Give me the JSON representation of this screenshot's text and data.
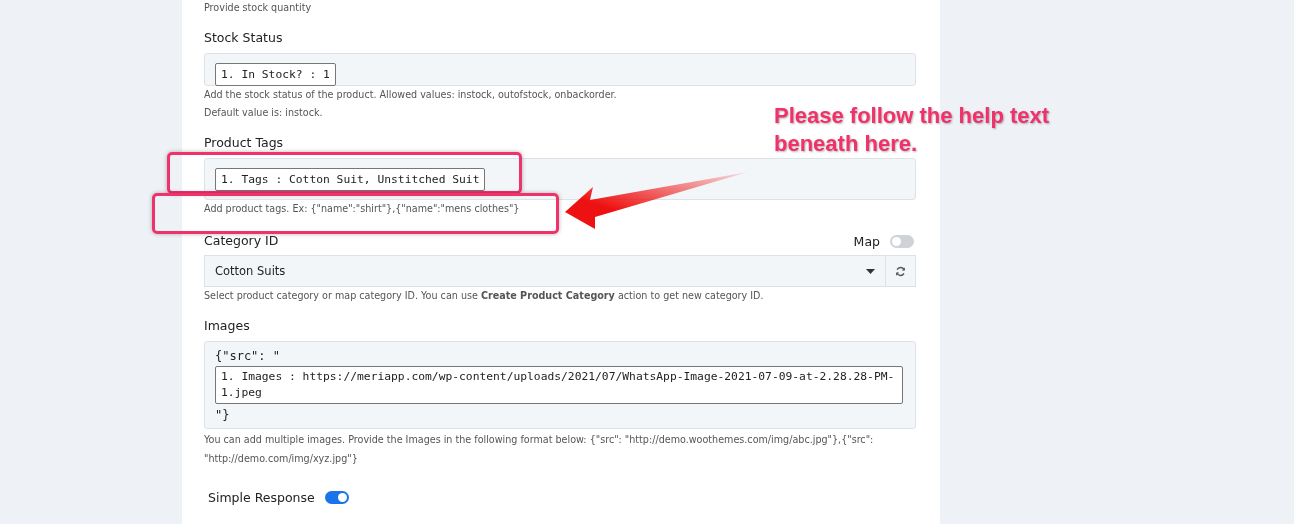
{
  "top_help": "Provide stock quantity",
  "stock_status": {
    "label": "Stock Status",
    "chip": "1. In Stock? : 1",
    "help": [
      "Add the stock status of the product. Allowed values: instock, outofstock, onbackorder.",
      "Default value is: instock."
    ]
  },
  "product_tags": {
    "label": "Product Tags",
    "chip": "1. Tags : Cotton Suit, Unstitched Suit",
    "help": "Add product tags. Ex: {\"name\":\"shirt\"},{\"name\":\"mens clothes\"}"
  },
  "category": {
    "label": "Category ID",
    "map_label": "Map",
    "map_on": false,
    "value": "Cotton Suits",
    "help": "Select product category or map category ID. You can use **Create Product Category** action to get new category ID."
  },
  "images": {
    "label": "Images",
    "prefix": "{\"src\": \"",
    "chip": "1. Images : https://meriapp.com/wp-content/uploads/2021/07/WhatsApp-Image-2021-07-09-at-2.28.28-PM-1.jpeg",
    "suffix": "\"}",
    "help": "You can add multiple images. Provide the Images in the following format below: {\"src\": \"http://demo.woothemes.com/img/abc.jpg\"},{\"src\": \"http://demo.com/img/xyz.jpg\"}"
  },
  "simple_response": {
    "label": "Simple Response",
    "on": true
  },
  "annotation": {
    "text": "Please follow the help text beneath here."
  }
}
